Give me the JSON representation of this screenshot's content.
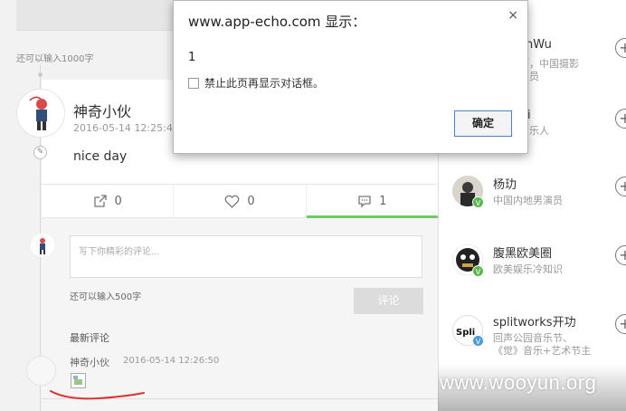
{
  "feed": {
    "char_limit_top": "还可以输入1000字",
    "post": {
      "author": "神奇小伙",
      "time": "2016-05-14 12:25:44",
      "text": "nice day"
    },
    "actions": [
      {
        "icon": "share-icon",
        "count": "0"
      },
      {
        "icon": "heart-icon",
        "count": "0"
      },
      {
        "icon": "comment-icon",
        "count": "1"
      }
    ],
    "comment_input": {
      "placeholder": "写下你精彩的评论...",
      "char_limit": "还可以输入500字",
      "submit_label": "评论"
    },
    "latest_label": "最新评论",
    "comment": {
      "author": "神奇小伙",
      "time": "2016-05-14 12:26:50"
    }
  },
  "sidebar": {
    "items": [
      {
        "name": "onWu",
        "desc1": "影师，中国摄影",
        "desc2": "员"
      },
      {
        "name": "i",
        "desc1": "乐人",
        "desc2": ""
      },
      {
        "name": "杨玏",
        "desc1": "中国内地男演员",
        "desc2": ""
      },
      {
        "name": "腹黑欧美圈",
        "desc1": "欧美娱乐冷知识",
        "desc2": ""
      },
      {
        "name": "splitworks开功",
        "desc1": "回声公园音乐节、",
        "desc2": "《觉》音乐+艺术节主"
      }
    ]
  },
  "dialog": {
    "title": "www.app-echo.com 显示：",
    "message": "1",
    "checkbox_label": "禁止此页再显示对话框。",
    "ok_label": "确定",
    "close_glyph": "×"
  },
  "watermark": "www.wooyun.org",
  "colors": {
    "accent_green": "#6fcb63",
    "verified_green": "#5bb84d",
    "annotation_red": "#e03030"
  }
}
